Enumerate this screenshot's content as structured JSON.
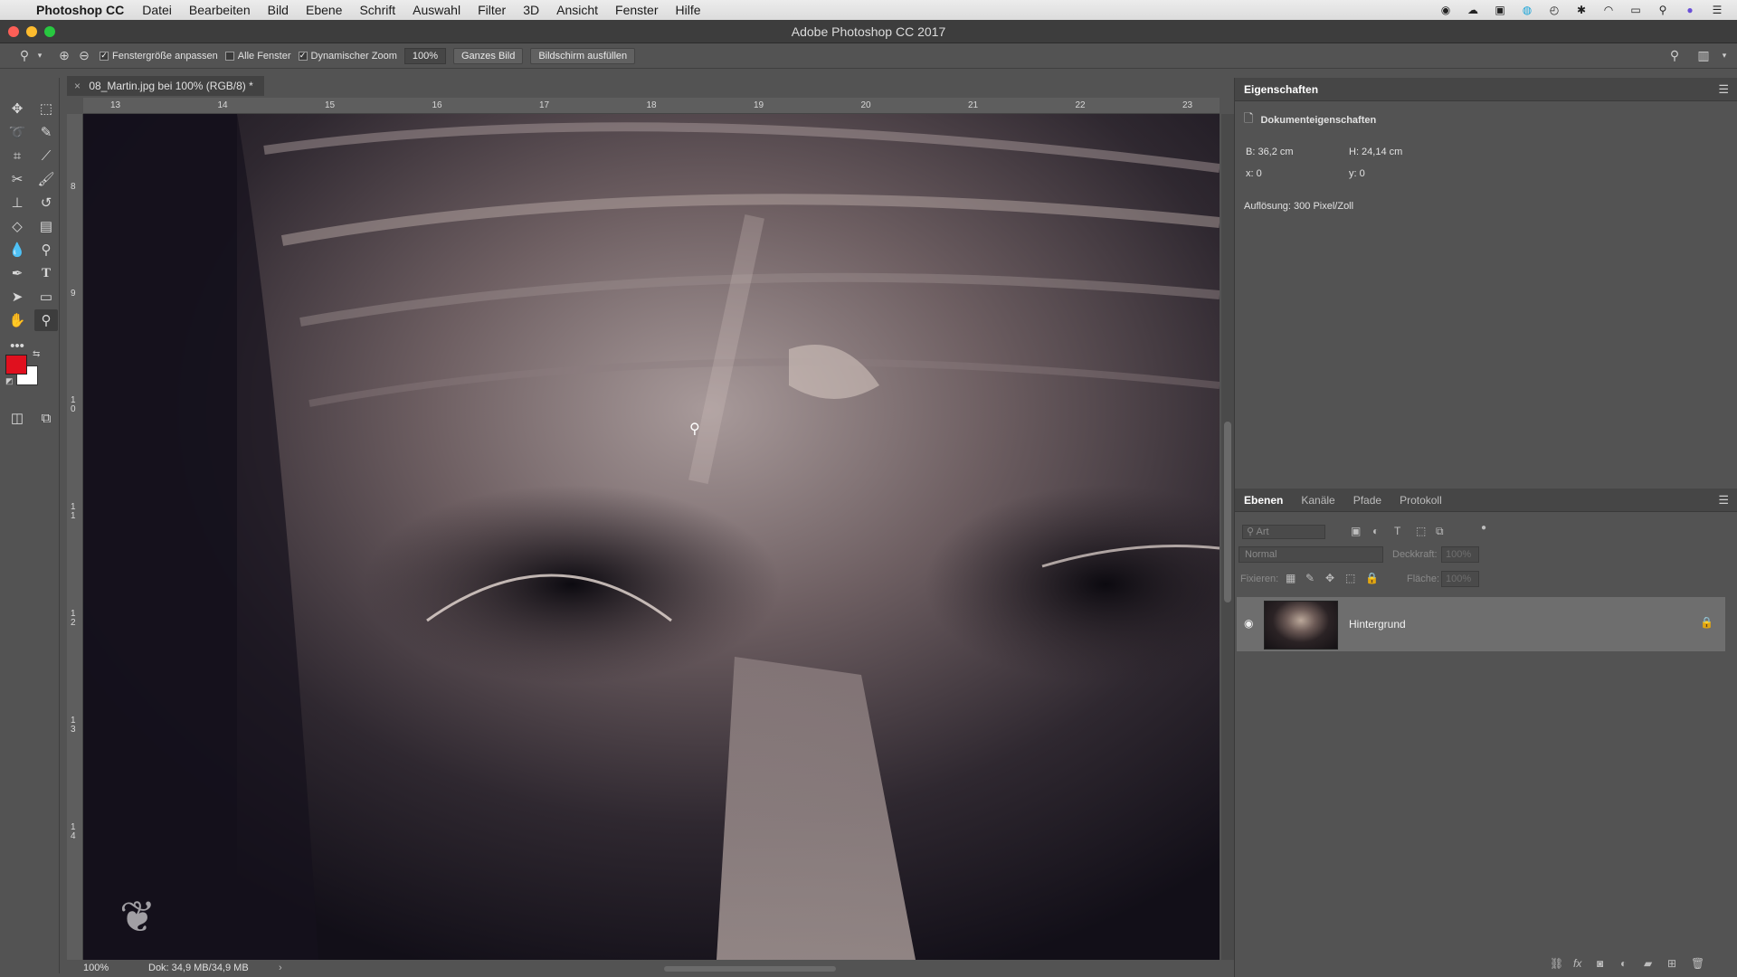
{
  "menubar": {
    "apple": "",
    "app_name": "Photoshop CC",
    "items": [
      "Datei",
      "Bearbeiten",
      "Bild",
      "Ebene",
      "Schrift",
      "Auswahl",
      "Filter",
      "3D",
      "Ansicht",
      "Fenster",
      "Hilfe"
    ],
    "tray_icons": [
      "record-icon",
      "creative-cloud-icon",
      "display-icon",
      "sync-icon",
      "time-machine-icon",
      "bluetooth-icon",
      "wifi-icon",
      "airplay-icon",
      "spotlight-icon",
      "siri-icon",
      "notification-icon"
    ]
  },
  "window": {
    "title": "Adobe Photoshop CC 2017"
  },
  "options": {
    "fit_window": "Fenstergröße anpassen",
    "fit_window_checked": true,
    "all_windows": "Alle Fenster",
    "all_windows_checked": false,
    "dynamic_zoom": "Dynamischer Zoom",
    "dynamic_zoom_checked": true,
    "zoom_value": "100%",
    "btn_full_image": "Ganzes Bild",
    "btn_fill_screen": "Bildschirm ausfüllen"
  },
  "tools": [
    "move-tool",
    "marquee-tool",
    "lasso-tool",
    "quick-selection-tool",
    "crop-tool",
    "eyedropper-tool",
    "healing-brush-tool",
    "brush-tool",
    "stamp-tool",
    "history-brush-tool",
    "eraser-tool",
    "gradient-tool",
    "blur-tool",
    "dodge-tool",
    "pen-tool",
    "type-tool",
    "path-selection-tool",
    "rectangle-tool",
    "hand-tool",
    "zoom-tool"
  ],
  "colors": {
    "foreground": "#e0101e",
    "background": "#ffffff"
  },
  "document": {
    "tab_title": "08_Martin.jpg bei 100% (RGB/8) *",
    "ruler_h_labels": [
      "13",
      "14",
      "15",
      "16",
      "17",
      "18",
      "19",
      "20",
      "21",
      "22",
      "23"
    ],
    "ruler_v_labels": [
      "8",
      "9",
      "1 0",
      "1 1",
      "1 2",
      "1 3",
      "1 4"
    ],
    "status_zoom": "100%",
    "status_doc": "Dok: 34,9 MB/34,9 MB"
  },
  "properties": {
    "tab": "Eigenschaften",
    "section": "Dokumenteigenschaften",
    "width": "B: 36,2 cm",
    "height": "H: 24,14 cm",
    "x": "x: 0",
    "y": "y: 0",
    "resolution": "Auflösung: 300 Pixel/Zoll"
  },
  "layers": {
    "tabs": [
      "Ebenen",
      "Kanäle",
      "Pfade",
      "Protokoll"
    ],
    "filter_placeholder": "Art",
    "blend_mode": "Normal",
    "opacity_label": "Deckkraft:",
    "opacity_value": "100%",
    "lock_label": "Fixieren:",
    "fill_label": "Fläche:",
    "fill_value": "100%",
    "layer_name": "Hintergrund"
  }
}
